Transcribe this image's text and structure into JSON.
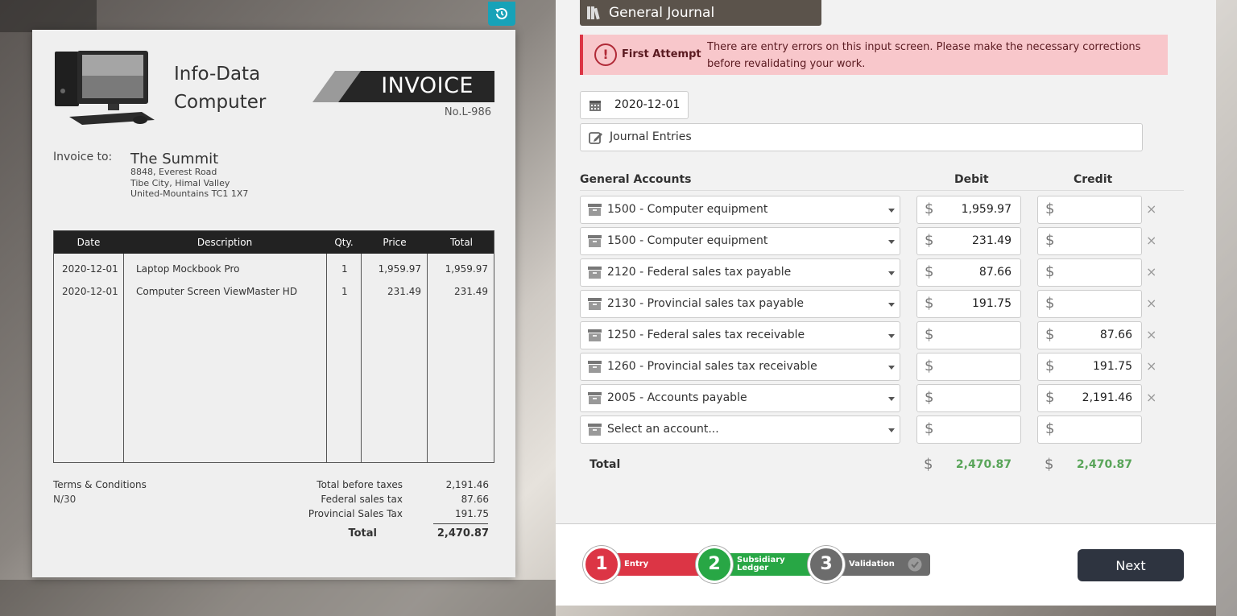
{
  "invoice": {
    "company_line1": "Info-Data",
    "company_line2": "Computer",
    "title": "INVOICE",
    "number": "No.L-986",
    "to_label": "Invoice to:",
    "to_name": "The Summit",
    "to_addr1": "8848, Everest Road",
    "to_addr2": "Tibe City, Himal Valley",
    "to_addr3": "United-Mountains TC1 1X7",
    "headers": [
      "Date",
      "Description",
      "Qty.",
      "Price",
      "Total"
    ],
    "rows": [
      {
        "date": "2020-12-01",
        "desc": "Laptop Mockbook Pro",
        "qty": "1",
        "price": "1,959.97",
        "total": "1,959.97"
      },
      {
        "date": "2020-12-01",
        "desc": "Computer Screen ViewMaster HD",
        "qty": "1",
        "price": "231.49",
        "total": "231.49"
      }
    ],
    "terms_label": "Terms & Conditions",
    "terms_value": "N/30",
    "summary": [
      {
        "label": "Total before taxes",
        "value": "2,191.46"
      },
      {
        "label": "Federal sales tax",
        "value": "87.66"
      },
      {
        "label": "Provincial Sales Tax",
        "value": "191.75"
      }
    ],
    "total_label": "Total",
    "total_value": "2,470.87"
  },
  "journal": {
    "title": "General Journal",
    "alert_label": "First Attempt",
    "alert_message": "There are entry errors on this input screen. Please make the necessary corrections before revalidating your work.",
    "date": "2020-12-01",
    "description": "Journal Entries",
    "col_accounts": "General Accounts",
    "col_debit": "Debit",
    "col_credit": "Credit",
    "currency": "$",
    "lines": [
      {
        "account": "1500 - Computer equipment",
        "debit": "1,959.97",
        "credit": ""
      },
      {
        "account": "1500 - Computer equipment",
        "debit": "231.49",
        "credit": ""
      },
      {
        "account": "2120 - Federal sales tax payable",
        "debit": "87.66",
        "credit": ""
      },
      {
        "account": "2130 - Provincial sales tax payable",
        "debit": "191.75",
        "credit": ""
      },
      {
        "account": "1250 - Federal sales tax receivable",
        "debit": "",
        "credit": "87.66"
      },
      {
        "account": "1260 - Provincial sales tax receivable",
        "debit": "",
        "credit": "191.75"
      },
      {
        "account": "2005 - Accounts payable",
        "debit": "",
        "credit": "2,191.46"
      },
      {
        "account": "Select an account...",
        "debit": "",
        "credit": ""
      }
    ],
    "delete_glyph": "×",
    "total_label": "Total",
    "total_debit": "2,470.87",
    "total_credit": "2,470.87"
  },
  "steps": [
    {
      "number": "1",
      "label": "Entry",
      "color": "#dc3545"
    },
    {
      "number": "2",
      "label_line1": "Subsidiary",
      "label_line2": "Ledger",
      "color": "#28a745"
    },
    {
      "number": "3",
      "label": "Validation",
      "color": "#6c6c6c"
    }
  ],
  "next_label": "Next",
  "colors": {
    "accent": "#17a2b8",
    "header": "#5b534b",
    "alert_bg": "#f8c7cb",
    "total_green": "#5aa55a"
  }
}
